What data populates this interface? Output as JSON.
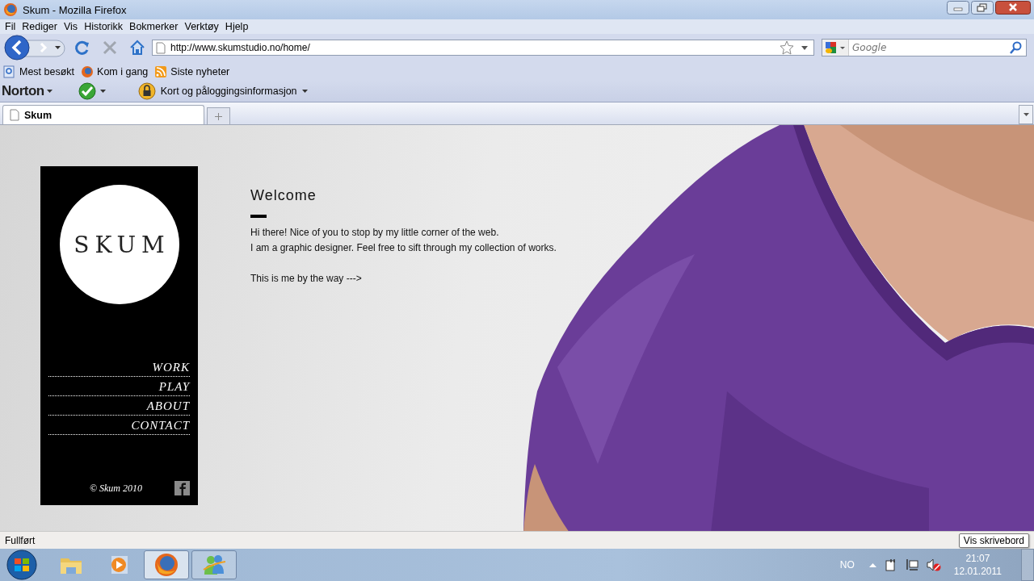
{
  "window": {
    "title": "Skum - Mozilla Firefox"
  },
  "menu": [
    "Fil",
    "Rediger",
    "Vis",
    "Historikk",
    "Bokmerker",
    "Verktøy",
    "Hjelp"
  ],
  "address": {
    "value": "http://www.skumstudio.no/home/"
  },
  "search": {
    "placeholder": "Google"
  },
  "bookmarks": [
    "Mest besøkt",
    "Kom i gang",
    "Siste nyheter"
  ],
  "norton": {
    "logo": "Norton",
    "login": "Kort og påloggingsinformasjon"
  },
  "tabs": [
    {
      "label": "Skum",
      "selected": true
    }
  ],
  "site": {
    "logo": "SKUM",
    "nav": [
      "WORK",
      "PLAY",
      "ABOUT",
      "CONTACT"
    ],
    "copyright": "© Skum 2010",
    "heading": "Welcome",
    "lines": [
      "Hi there! Nice of you to stop by my little corner of the web.",
      "I am a graphic designer. Feel free to sift through my collection of works."
    ],
    "note": "This is me by the way --->"
  },
  "status": "Fullført",
  "taskbar": {
    "apps": [
      {
        "kind": "folder",
        "running": false,
        "selected": false
      },
      {
        "kind": "media",
        "running": false,
        "selected": false
      },
      {
        "kind": "browser",
        "running": true,
        "selected": true
      },
      {
        "kind": "messenger",
        "running": true,
        "selected": false
      }
    ],
    "language": "NO",
    "time": "21:07",
    "date": "12.01.2011"
  },
  "tooltip": "Vis skrivebord"
}
